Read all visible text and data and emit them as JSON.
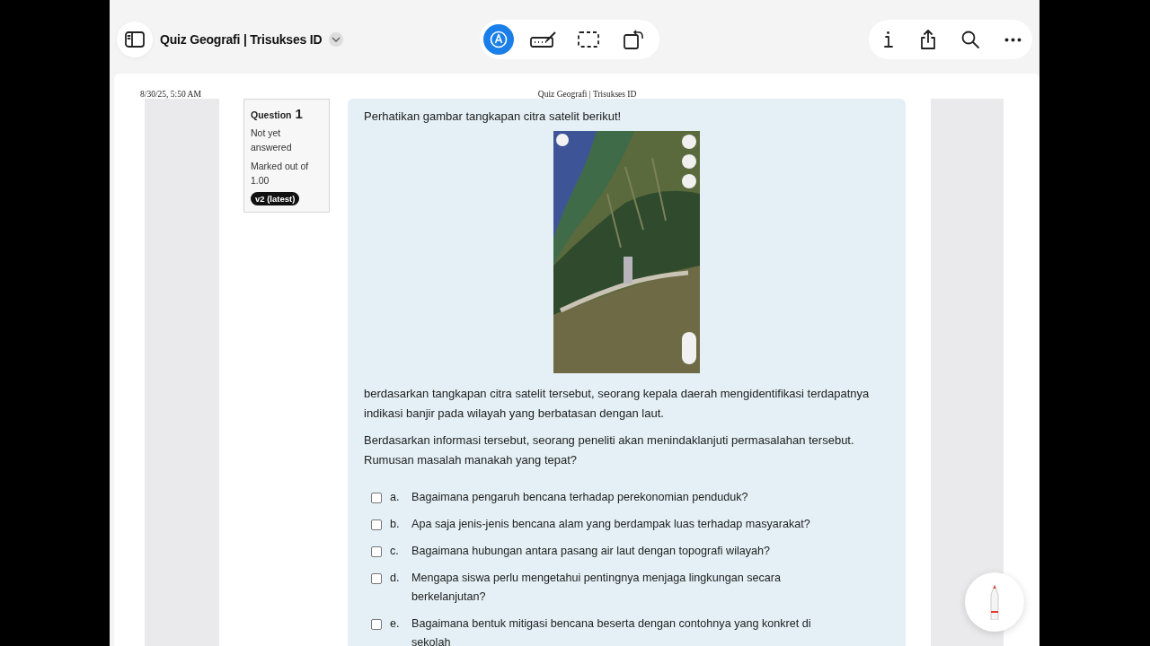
{
  "toolbar": {
    "title": "Quiz Geografi | Trisukses ID",
    "tools": [
      {
        "kind": "markup",
        "selected": true
      },
      {
        "kind": "text-box",
        "selected": false
      },
      {
        "kind": "select",
        "selected": false
      },
      {
        "kind": "rotate",
        "selected": false
      }
    ],
    "actions": [
      {
        "kind": "info"
      },
      {
        "kind": "share"
      },
      {
        "kind": "search"
      },
      {
        "kind": "more"
      }
    ]
  },
  "page_header": {
    "date": "8/30/25, 5:50 AM",
    "title": "Quiz Geografi | Trisukses ID"
  },
  "question_info": {
    "label": "Question",
    "number": "1",
    "status": "Not yet answered",
    "marks": "Marked out of 1.00",
    "version": "v2 (latest)"
  },
  "question": {
    "prompt": "Perhatikan gambar tangkapan citra satelit berikut!",
    "paragraphs": [
      "berdasarkan tangkapan citra satelit tersebut, seorang kepala daerah mengidentifikasi terdapatnya indikasi banjir pada wilayah yang berbatasan dengan laut.",
      "Berdasarkan informasi tersebut, seorang peneliti akan menindaklanjuti permasalahan tersebut. Rumusan masalah manakah yang tepat?"
    ],
    "options": [
      {
        "letter": "a.",
        "text": "Bagaimana pengaruh bencana terhadap perekonomian penduduk?",
        "checked": false
      },
      {
        "letter": "b.",
        "text": "Apa saja jenis-jenis bencana alam yang berdampak luas terhadap masyarakat?",
        "checked": false
      },
      {
        "letter": "c.",
        "text": "Bagaimana hubungan antara pasang air laut dengan topografi wilayah?",
        "checked": false
      },
      {
        "letter": "d.",
        "text": "Mengapa siswa perlu mengetahui pentingnya menjaga lingkungan secara berkelanjutan?",
        "checked": false
      },
      {
        "letter": "e.",
        "text": "Bagaimana bentuk mitigasi bencana beserta dengan contohnya yang konkret di sekolah",
        "checked": false
      }
    ]
  }
}
